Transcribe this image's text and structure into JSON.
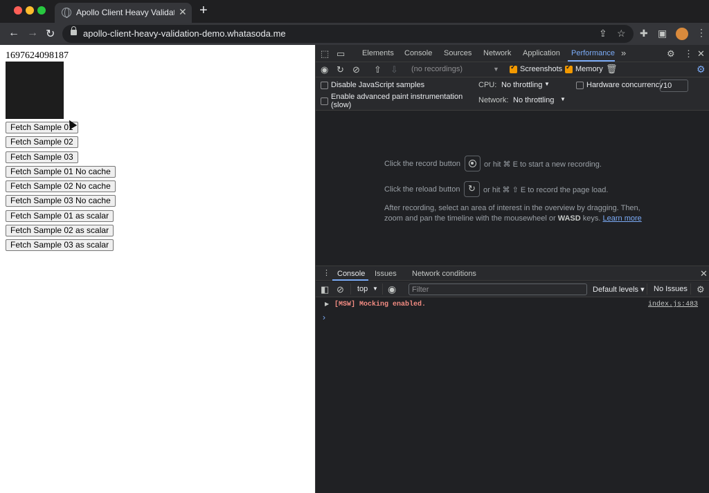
{
  "browser": {
    "tab_title": "Apollo Client Heavy Validation",
    "new_tab_symbol": "+",
    "tab_close_symbol": "✕",
    "url": "apollo-client-heavy-validation-demo.whatasoda.me"
  },
  "page": {
    "timestamp": "1697624098187",
    "buttons": [
      "Fetch Sample 01",
      "Fetch Sample 02",
      "Fetch Sample 03",
      "Fetch Sample 01 No cache",
      "Fetch Sample 02 No cache",
      "Fetch Sample 03 No cache",
      "Fetch Sample 01 as scalar",
      "Fetch Sample 02 as scalar",
      "Fetch Sample 03 as scalar"
    ]
  },
  "devtools": {
    "tabs": [
      "Elements",
      "Console",
      "Sources",
      "Network",
      "Application",
      "Performance"
    ],
    "active_tab": "Performance",
    "more_tabs": "»",
    "perf_toolbar": {
      "recordings_placeholder": "(no recordings)",
      "screenshots_label": "Screenshots",
      "memory_label": "Memory"
    },
    "perf_settings": {
      "disable_js_samples": "Disable JavaScript samples",
      "advanced_paint_1": "Enable advanced paint instrumentation",
      "advanced_paint_2": "(slow)",
      "cpu_label": "CPU:",
      "cpu_value": "No throttling",
      "network_label": "Network:",
      "network_value": "No throttling",
      "hardware_concurrency": "Hardware concurrency",
      "hardware_concurrency_value": "10"
    },
    "perf_main": {
      "record_pre": "Click the record button",
      "record_post": "or hit ⌘ E to start a new recording.",
      "reload_pre": "Click the reload button",
      "reload_post": "or hit ⌘ ⇧ E to record the page load.",
      "after_1": "After recording, select an area of interest in the overview by dragging. Then,",
      "after_2a": "zoom and pan the timeline with the mousewheel or",
      "after_2b": "WASD",
      "after_2c": "keys.",
      "learn_more": "Learn more"
    },
    "drawer_tabs": [
      "Console",
      "Issues",
      "Network conditions"
    ],
    "console_toolbar": {
      "context": "top",
      "filter_placeholder": "Filter",
      "levels": "Default levels ▾",
      "issues": "No Issues"
    },
    "console_log": {
      "message": "[MSW] Mocking enabled.",
      "source": "index.js:483"
    }
  }
}
